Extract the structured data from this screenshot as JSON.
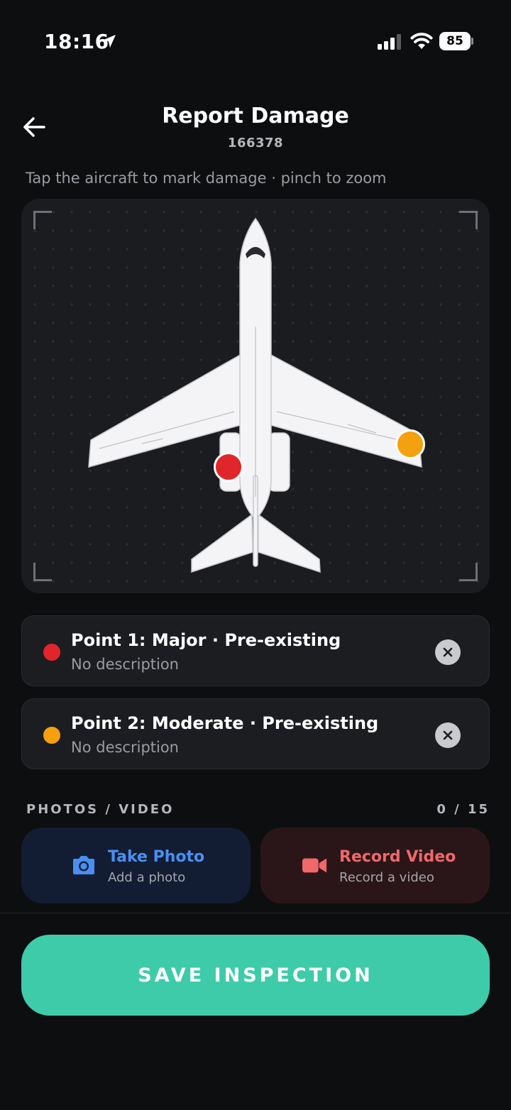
{
  "status_bar": {
    "time": "18:16",
    "battery": "85",
    "icons": [
      "location-arrow-icon",
      "cellular-signal-icon",
      "wifi-icon",
      "battery-icon"
    ]
  },
  "header": {
    "title": "Report Damage",
    "subtitle": "166378",
    "back_icon": "arrow-left-icon"
  },
  "hint": "Tap the aircraft to mark damage · pinch to zoom",
  "damage_points": [
    {
      "title": "Point 1: Major · Pre-existing",
      "description": "No description",
      "color": "#e0262b"
    },
    {
      "title": "Point 2: Moderate · Pre-existing",
      "description": "No description",
      "color": "#f5a00f"
    }
  ],
  "media": {
    "section_label": "PHOTOS / VIDEO",
    "count": "0 / 15",
    "photo": {
      "title": "Take Photo",
      "subtitle": "Add a photo",
      "icon": "camera-icon",
      "color": "#4a8ff0"
    },
    "video": {
      "title": "Record Video",
      "subtitle": "Record a video",
      "icon": "video-camera-icon",
      "color": "#f0686a"
    }
  },
  "save_label": "SAVE INSPECTION",
  "colors": {
    "accent": "#3ecbaa",
    "background": "#0d0e10",
    "card": "#1c1d21"
  }
}
